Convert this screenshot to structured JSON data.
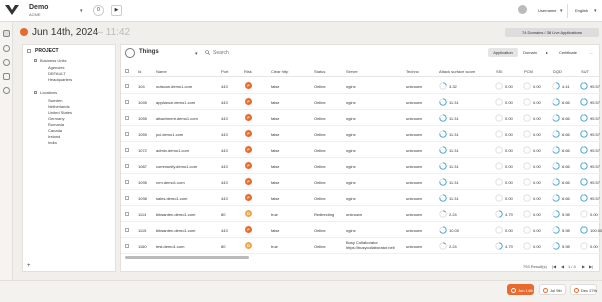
{
  "header": {
    "org_name": "Demo",
    "org_sub": "ACME",
    "counter": "0",
    "play": "▶",
    "username": "Username",
    "language": "English"
  },
  "date_bar": {
    "date": "Jun 14th, 2024",
    "time": "— 11:42",
    "status": "74 Domains / 38 Live Applications"
  },
  "tree": {
    "project": "PROJECT",
    "business_units": "Business Units",
    "bu_items": [
      "Agencies",
      "DEFAULT",
      "Headquarters"
    ],
    "locations": "Locations",
    "loc_items": [
      "Sweden",
      "Netherlands",
      "United States",
      "Germany",
      "Romania",
      "Canada",
      "Ireland",
      "India"
    ],
    "add": "+"
  },
  "main": {
    "title": "Things",
    "search_placeholder": "Search",
    "tabs": [
      "Application",
      "Domain",
      "Certificate"
    ],
    "tabs_sep": "▸",
    "more": "..."
  },
  "table": {
    "columns": [
      "Id",
      "Name",
      "Port",
      "Risk",
      "Clear http",
      "Status",
      "Server",
      "Techno",
      "Attack surface score",
      "SSI",
      "PCM",
      "DQD",
      "SUT"
    ],
    "rows": [
      {
        "id": "104",
        "name": "outscan.demo1.com",
        "port": "443",
        "risk": "F",
        "clear": "false",
        "status": "Online",
        "server": "nginx",
        "techno": "unknown",
        "score": "3.32",
        "ssi": "0.00",
        "pcm": "0.00",
        "dqd": "4.41",
        "sut": "95.57"
      },
      {
        "id": "1045",
        "name": "appliance.demo1.com",
        "port": "443",
        "risk": "F",
        "clear": "false",
        "status": "Online",
        "server": "nginx",
        "techno": "unknown",
        "score": "11.31",
        "ssi": "0.00",
        "pcm": "0.00",
        "dqd": "6.66",
        "sut": "95.57"
      },
      {
        "id": "1055",
        "name": "attachment.demo1.com",
        "port": "443",
        "risk": "F",
        "clear": "false",
        "status": "Online",
        "server": "nginx",
        "techno": "unknown",
        "score": "11.31",
        "ssi": "0.00",
        "pcm": "0.00",
        "dqd": "6.66",
        "sut": "95.57"
      },
      {
        "id": "1059",
        "name": "pci.demo1.com",
        "port": "443",
        "risk": "F",
        "clear": "false",
        "status": "Online",
        "server": "nginx",
        "techno": "unknown",
        "score": "11.31",
        "ssi": "0.00",
        "pcm": "0.00",
        "dqd": "6.66",
        "sut": "95.57"
      },
      {
        "id": "1072",
        "name": "admin.demo1.com",
        "port": "443",
        "risk": "F",
        "clear": "false",
        "status": "Online",
        "server": "nginx",
        "techno": "unknown",
        "score": "11.31",
        "ssi": "0.00",
        "pcm": "0.00",
        "dqd": "6.66",
        "sut": "95.57"
      },
      {
        "id": "1087",
        "name": "community.demo1.com",
        "port": "443",
        "risk": "F",
        "clear": "false",
        "status": "Online",
        "server": "nginx",
        "techno": "unknown",
        "score": "11.31",
        "ssi": "0.00",
        "pcm": "0.00",
        "dqd": "6.66",
        "sut": "95.57"
      },
      {
        "id": "1095",
        "name": "crm.demo1.com",
        "port": "443",
        "risk": "F",
        "clear": "false",
        "status": "Online",
        "server": "nginx",
        "techno": "unknown",
        "score": "11.31",
        "ssi": "0.00",
        "pcm": "0.00",
        "dqd": "6.66",
        "sut": "95.57"
      },
      {
        "id": "1098",
        "name": "sales.demo1.com",
        "port": "443",
        "risk": "F",
        "clear": "false",
        "status": "Online",
        "server": "nginx",
        "techno": "unknown",
        "score": "11.31",
        "ssi": "0.00",
        "pcm": "0.00",
        "dqd": "6.66",
        "sut": "95.57"
      },
      {
        "id": "1114",
        "name": "bitwarden.demo1.com",
        "port": "80",
        "risk": "D",
        "clear": "true",
        "status": "Redirecting",
        "server": "unknown",
        "techno": "unknown",
        "score": "2.24",
        "ssi": "4.79",
        "pcm": "0.00",
        "dqd": "5.98",
        "sut": "0.00"
      },
      {
        "id": "1115",
        "name": "bitwarden.demo1.com",
        "port": "443",
        "risk": "F",
        "clear": "false",
        "status": "Online",
        "server": "nginx",
        "techno": "unknown",
        "score": "10.00",
        "ssi": "0.00",
        "pcm": "0.00",
        "dqd": "5.98",
        "sut": "100.00"
      },
      {
        "id": "1160",
        "name": "test.demo1.com",
        "port": "80",
        "risk": "D",
        "clear": "true",
        "status": "Online",
        "server": "Busy Collaborator https://busycollaborator.net/",
        "techno": "unknown",
        "score": "2.24",
        "ssi": "4.79",
        "pcm": "0.00",
        "dqd": "5.98",
        "sut": "0.00"
      }
    ]
  },
  "pager": {
    "results": "793 Result(s)",
    "first": "|◀",
    "prev": "◀",
    "page": "1 / 4",
    "next": "▶",
    "last": "▶|"
  },
  "bottom": {
    "pills": [
      "Jun 14th",
      "Jul 9th",
      "Dec 27th"
    ]
  },
  "colors": {
    "accent": "#e86a2c",
    "risk_F": "#e86a2c",
    "risk_D": "#f0a54a",
    "ring": "#3aa0d8"
  }
}
